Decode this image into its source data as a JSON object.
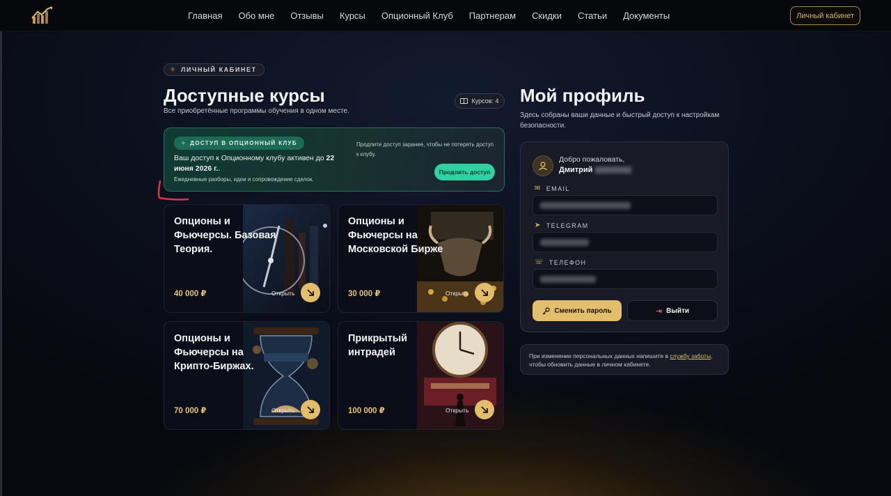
{
  "header": {
    "nav": [
      "Главная",
      "Обо мне",
      "Отзывы",
      "Курсы",
      "Опционный Клуб",
      "Партнерам",
      "Скидки",
      "Статьи",
      "Документы"
    ],
    "cabinet_button": "Личный кабинет"
  },
  "courses_section": {
    "badge": "ЛИЧНЫЙ КАБИНЕТ",
    "title": "Доступные курсы",
    "subtitle": "Все приобретённые программы обучения в одном месте.",
    "count": "Курсов: 4"
  },
  "club": {
    "badge": "ДОСТУП В ОПЦИОННЫЙ КЛУБ",
    "text_prefix": "Ваш доступ к Опционному клубу активен до ",
    "text_date": "22 июня 2026 г.",
    "text_suffix": ".",
    "small": "Ежедневные разборы, идеи и сопровождение сделок.",
    "note": "Продлите доступ заранее, чтобы не потерять доступ к клубу.",
    "renew_button": "Продлить доступ"
  },
  "courses": [
    {
      "title": "Опционы и Фьючерсы. Базовая Теория.",
      "price": "40 000 ₽",
      "open": "Открыть"
    },
    {
      "title": "Опционы и Фьючерсы на Московской Бирже",
      "price": "30 000 ₽",
      "open": "Открыть"
    },
    {
      "title": "Опционы и Фьючерсы на Крипто-Биржах.",
      "price": "70 000 ₽",
      "open": "Открыть"
    },
    {
      "title": "Прикрытый интрадей",
      "price": "100 000 ₽",
      "open": "Открыть"
    }
  ],
  "profile": {
    "title": "Мой профиль",
    "subtitle": "Здесь собраны ваши данные и быстрый доступ к настройкам безопасности.",
    "welcome": "Добро пожаловать,",
    "name": "Дмитрий",
    "email_label": "EMAIL",
    "telegram_label": "TELEGRAM",
    "phone_label": "ТЕЛЕФОН",
    "change_password": "Сменить пароль",
    "logout": "Выйти",
    "notice_prefix": "При изменении персональных данных напишите в ",
    "notice_link": "службу заботы",
    "notice_suffix": ", чтобы обновить данные в личном кабинете."
  },
  "colors": {
    "accent": "#e2bd6c",
    "club_green": "#2fd2a0",
    "background": "#0b0f1c"
  }
}
